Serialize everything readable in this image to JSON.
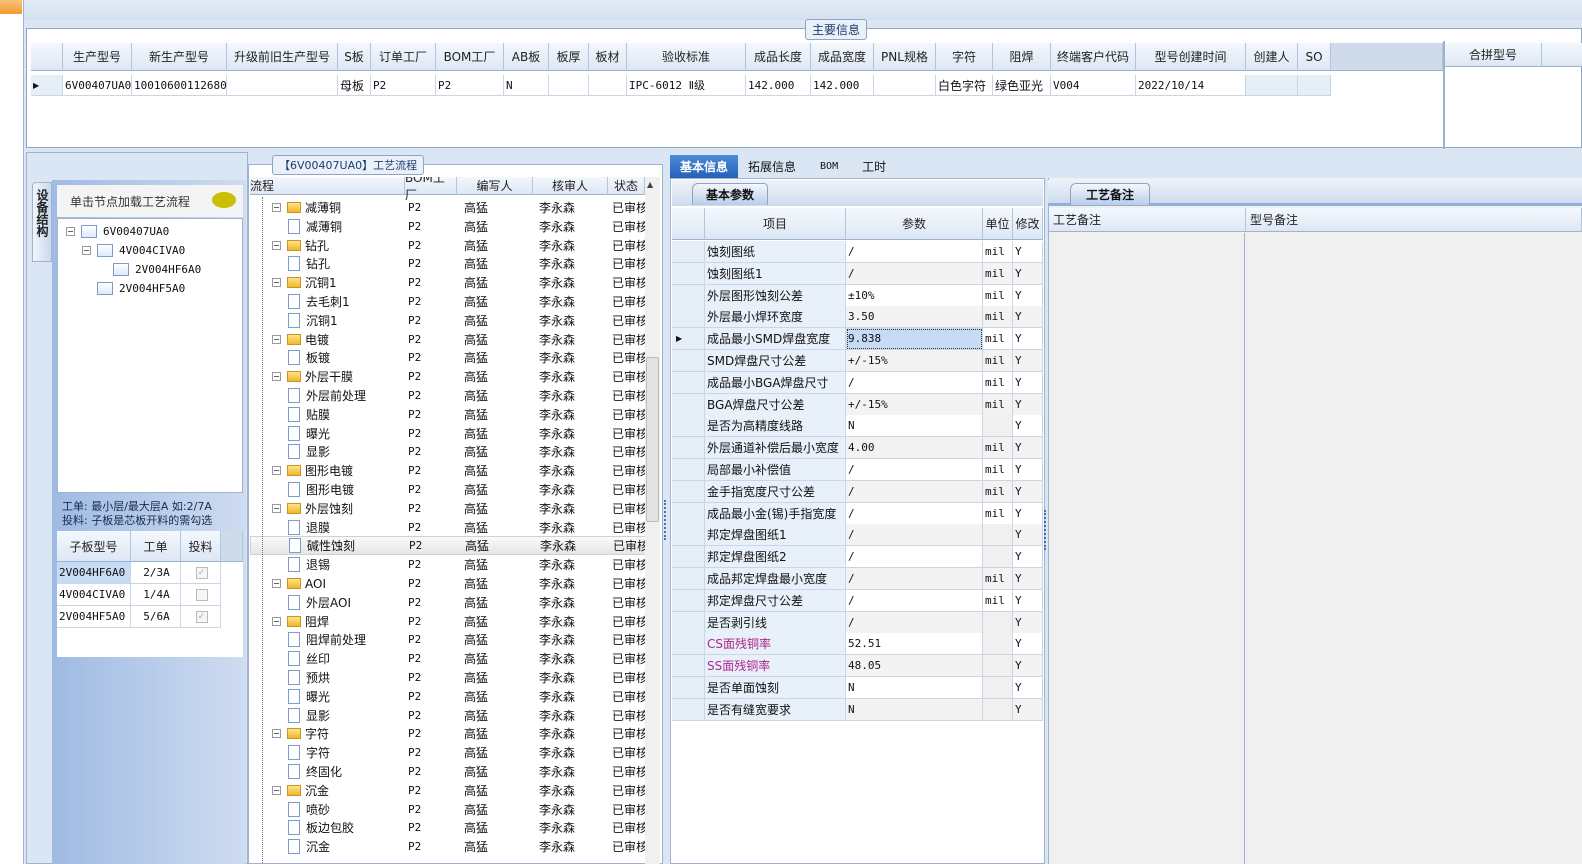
{
  "main_info": {
    "title": "主要信息",
    "columns": [
      "生产型号",
      "新生产型号",
      "升级前旧生产型号",
      "S板",
      "订单工厂",
      "BOM工厂",
      "AB板",
      "板厚",
      "板材",
      "验收标准",
      "成品长度",
      "成品宽度",
      "PNL规格",
      "字符",
      "阻焊",
      "终端客户代码",
      "型号创建时间",
      "创建人",
      "SO"
    ],
    "row": [
      "6V00407UA0",
      "10010600112680",
      "",
      "母板",
      "P2",
      "P2",
      "N",
      "",
      "",
      "IPC-6012 Ⅱ级",
      "142.000",
      "142.000",
      "",
      "白色字符",
      "绿色亚光",
      "V004",
      "2022/10/14",
      "",
      ""
    ],
    "merge_header": "合拼型号"
  },
  "structure": {
    "vertical_tab": "设备结构",
    "header": "单击节点加载工艺流程",
    "tree": [
      {
        "label": "6V00407UA0",
        "level": 0
      },
      {
        "label": "4V004CIVA0",
        "level": 1
      },
      {
        "label": "2V004HF6A0",
        "level": 2
      },
      {
        "label": "2V004HF5A0",
        "level": 1
      }
    ],
    "hint1": "工单: 最小层/最大层A 如:2/7A",
    "hint2": "投料: 子板是芯板开料的需勾选",
    "sub_columns": [
      "子板型号",
      "工单",
      "投料"
    ],
    "sub_rows": [
      {
        "model": "2V004HF6A0",
        "order": "2/3A",
        "feed": true
      },
      {
        "model": "4V004CIVA0",
        "order": "1/4A",
        "feed": false
      },
      {
        "model": "2V004HF5A0",
        "order": "5/6A",
        "feed": true
      }
    ]
  },
  "process": {
    "title": "【6V00407UA0】工艺流程",
    "columns": [
      "流程",
      "BOM工厂",
      "编写人",
      "核审人",
      "状态"
    ],
    "rows": [
      [
        "减薄铜",
        0
      ],
      [
        "减薄铜",
        1
      ],
      [
        "钻孔",
        0
      ],
      [
        "钻孔",
        1
      ],
      [
        "沉铜1",
        0
      ],
      [
        "去毛刺1",
        1
      ],
      [
        "沉铜1",
        1
      ],
      [
        "电镀",
        0
      ],
      [
        "板镀",
        1
      ],
      [
        "外层干膜",
        0
      ],
      [
        "外层前处理",
        1
      ],
      [
        "贴膜",
        1
      ],
      [
        "曝光",
        1
      ],
      [
        "显影",
        1
      ],
      [
        "图形电镀",
        0
      ],
      [
        "图形电镀",
        1
      ],
      [
        "外层蚀刻",
        0
      ],
      [
        "退膜",
        1
      ],
      [
        "碱性蚀刻",
        1
      ],
      [
        "退锡",
        1
      ],
      [
        "AOI",
        0
      ],
      [
        "外层AOI",
        1
      ],
      [
        "阻焊",
        0
      ],
      [
        "阻焊前处理",
        1
      ],
      [
        "丝印",
        1
      ],
      [
        "预烘",
        1
      ],
      [
        "曝光",
        1
      ],
      [
        "显影",
        1
      ],
      [
        "字符",
        0
      ],
      [
        "字符",
        1
      ],
      [
        "终固化",
        1
      ],
      [
        "沉金",
        0
      ],
      [
        "喷砂",
        1
      ],
      [
        "板边包胶",
        1
      ],
      [
        "沉金",
        1
      ]
    ],
    "bom": "P2",
    "writer": "高猛",
    "reviewer": "李永森",
    "status": "已审核",
    "selected_index": 18
  },
  "tabs": [
    "基本信息",
    "拓展信息",
    "BOM",
    "工时"
  ],
  "params": {
    "tab": "基本参数",
    "columns": [
      "项目",
      "参数",
      "单位",
      "修改"
    ],
    "selected_index": 4,
    "rows": [
      [
        "蚀刻图纸",
        "/",
        "mil",
        "Y"
      ],
      [
        "蚀刻图纸1",
        "/",
        "mil",
        "Y"
      ],
      [
        "外层图形蚀刻公差",
        "±10%",
        "mil",
        "Y"
      ],
      [
        "外层最小焊环宽度",
        "3.50",
        "mil",
        "Y"
      ],
      [
        "成品最小SMD焊盘宽度",
        "9.838",
        "mil",
        "Y"
      ],
      [
        "SMD焊盘尺寸公差",
        "+/-15%",
        "mil",
        "Y"
      ],
      [
        "成品最小BGA焊盘尺寸",
        "/",
        "mil",
        "Y"
      ],
      [
        "BGA焊盘尺寸公差",
        "+/-15%",
        "mil",
        "Y"
      ],
      [
        "是否为高精度线路",
        "N",
        "",
        "Y"
      ],
      [
        "外层通道补偿后最小宽度",
        "4.00",
        "mil",
        "Y"
      ],
      [
        "局部最小补偿值",
        "/",
        "mil",
        "Y"
      ],
      [
        "金手指宽度尺寸公差",
        "/",
        "mil",
        "Y"
      ],
      [
        "成品最小金(锡)手指宽度",
        "/",
        "mil",
        "Y"
      ],
      [
        "邦定焊盘图纸1",
        "/",
        "",
        "Y"
      ],
      [
        "邦定焊盘图纸2",
        "/",
        "",
        "Y"
      ],
      [
        "成品邦定焊盘最小宽度",
        "/",
        "mil",
        "Y"
      ],
      [
        "邦定焊盘尺寸公差",
        "/",
        "mil",
        "Y"
      ],
      [
        "是否剥引线",
        "/",
        "",
        "Y"
      ],
      [
        "CS面残铜率",
        "52.51",
        "",
        "Y"
      ],
      [
        "SS面残铜率",
        "48.05",
        "",
        "Y"
      ],
      [
        "是否单面蚀刻",
        "N",
        "",
        "Y"
      ],
      [
        "是否有缝宽要求",
        "N",
        "",
        "Y"
      ]
    ],
    "highlight_rows": [
      18,
      19
    ],
    "highlight_color": "#b0268a"
  },
  "notes": {
    "tab": "工艺备注",
    "columns": [
      "工艺备注",
      "型号备注"
    ]
  }
}
